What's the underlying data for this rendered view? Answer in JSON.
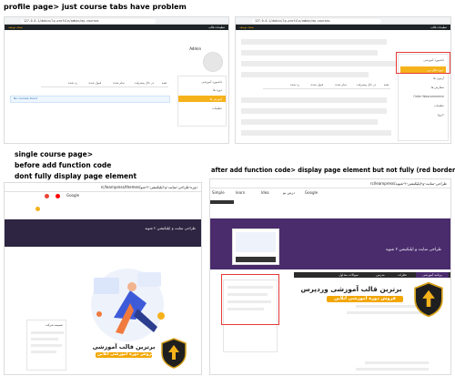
{
  "captions": {
    "top": "profile page> just course tabs  have problem",
    "bottom_left_1": "single course page>",
    "bottom_left_2": "before add function code",
    "bottom_left_3": "dont fully display page element",
    "bottom_right": "after add function code> display page element but not fully (red border )"
  },
  "panel_profile_left": {
    "url": "127.0.0.1/dokin/lp-profile/admin/my-courses",
    "username": "Admin",
    "sidebar_items": [
      "داشبورد آموزشی",
      "دوره ها",
      "آموزش ها",
      "تنظیمات"
    ],
    "active_item": "دوره ها",
    "tabs": [
      "همه",
      "در حال پیشرفت",
      "تمام شده",
      "قبول شده",
      "رد شده"
    ],
    "notice": "No courses found"
  },
  "panel_profile_right": {
    "url": "127.0.0.1/dokin/lp-profile/admin/my-courses",
    "sidebar_items": [
      "داشبورد آموزشی",
      "دوره های من",
      "آزمون ها",
      "سفارش ها",
      "Order Woocommerce",
      "تنظیمات",
      "خروج"
    ],
    "active_item": "دوره های من",
    "tabs": [
      "همه",
      "در حال پیشرفت",
      "تمام شده",
      "قبول شده",
      "رد شده"
    ]
  },
  "panel_course_left": {
    "url": "دوره-طراحی-سایت-و-اپلیکیشن-۲-شو/rc/learnpress/themes",
    "bookmarks": [
      "Gmail",
      "YouTube",
      "Google"
    ],
    "hero_title": "طراحی سایت و اپلیکیشن ۲ شوید",
    "promo_title": "برترین قالب آموزشی",
    "promo_sub": "فروش دوره آموزشی آنلاین",
    "sidebar_label": "ضمیمه شرکت"
  },
  "panel_course_right": {
    "url": "طراحی-سایت-و-اپلیکیشن-۲-شوید/rc/learnpress",
    "bookmarks": [
      "Simple",
      "learn",
      "Idea",
      "درس نو",
      "Google"
    ],
    "hero_title": "طراحی سایت و اپلیکیشن ۲ شوید",
    "tabs": [
      "برنامه آموزشی",
      "نظرات",
      "مدرس",
      "سوالات متداول"
    ],
    "promo_title": "برترین قالب آموزشی وردپرس",
    "promo_sub": "فروش دوره آموزشی آنلاین"
  },
  "wp_admin_bar": {
    "site_label": "تنظیمات قالب",
    "dev_label": "نسخه توسعه"
  },
  "colors": {
    "accent": "#f5b21b",
    "dark_bar": "#1d2327",
    "hero_dark": "#2e2542",
    "hero_purple": "#4a2c6d",
    "highlight": "#e53935"
  }
}
